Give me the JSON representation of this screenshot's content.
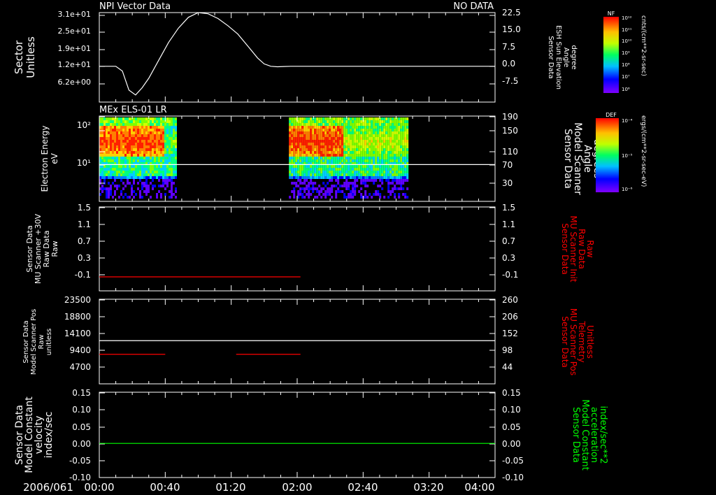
{
  "colors": {
    "background": "#000000",
    "axes": "#ffffff",
    "red_trace": "#ff0000",
    "green_trace": "#00ff00"
  },
  "footer": {
    "date": "2006/061",
    "time_ticks": [
      "00:00",
      "00:40",
      "01:20",
      "02:00",
      "02:40",
      "03:20",
      "04:00"
    ]
  },
  "chart_data": [
    {
      "type": "line",
      "panel": "npi",
      "title": "NPI Vector Data",
      "status": "NO DATA",
      "ylabel_left": [
        "Sector",
        "Unitless"
      ],
      "yticks_left": [
        "3.1e+01",
        "2.5e+01",
        "1.9e+01",
        "1.2e+01",
        "6.2e+00"
      ],
      "ylabel_right": [
        "Sensor Data",
        "ESH Sun Elevation",
        "Angle",
        "degree"
      ],
      "yticks_right": [
        "22.5",
        "15.0",
        "7.5",
        "0.0",
        "-7.5"
      ],
      "ylim_right": [
        -15,
        22.5
      ],
      "series": [
        {
          "x": [
            0,
            10,
            14,
            18,
            22,
            26,
            30,
            36,
            42,
            48,
            54,
            60,
            66,
            72,
            78,
            84,
            90,
            96,
            100,
            104,
            108,
            112,
            116,
            120,
            240
          ],
          "y": [
            0,
            0,
            -2,
            -10,
            -12,
            -9,
            -5,
            2.5,
            10,
            16,
            20.5,
            22.5,
            22,
            20,
            17,
            13.5,
            8.5,
            3.5,
            1,
            0,
            -0.2,
            -0.1,
            0,
            0,
            0
          ]
        }
      ]
    },
    {
      "type": "heatmap",
      "panel": "els",
      "title": "MEx ELS-01 LR",
      "ylabel_left": [
        "Electron Energy",
        "eV"
      ],
      "yticks_left": [
        "10²",
        "10¹"
      ],
      "ylabel_right": [
        "Sensor Data",
        "Model Scanner",
        "Angle",
        "degrees"
      ],
      "yticks_right": [
        "190",
        "150",
        "110",
        "70",
        "30"
      ],
      "ylim_right": [
        0,
        190
      ],
      "blocks": [
        {
          "x_start": 0,
          "x_end": 46
        },
        {
          "x_start": 115,
          "x_end": 187
        }
      ],
      "overlay_line": {
        "y": 82
      }
    },
    {
      "type": "line",
      "panel": "mu_raw",
      "ylabel_left": [
        "Sensor Data",
        "MU Scanner +30V",
        "Raw Data",
        "Raw"
      ],
      "yticks_left": [
        "1.5",
        "1.1",
        "0.7",
        "0.3",
        "-0.1"
      ],
      "ylabel_right": [
        "Sensor Data",
        "MU Scanner Init",
        "Raw Data",
        "Raw"
      ],
      "yticks_right": [
        "1.5",
        "1.1",
        "0.7",
        "0.3",
        "-0.1"
      ],
      "ylim": [
        -0.3,
        1.5
      ],
      "series": [
        {
          "x": [
            0,
            122
          ],
          "y": [
            0,
            0
          ],
          "color": "#ff0000"
        }
      ]
    },
    {
      "type": "line",
      "panel": "mu_pos",
      "ylabel_left": [
        "Sensor Data",
        "Model Scanner Pos",
        "Raw",
        "unitless"
      ],
      "yticks_left": [
        "23500",
        "18800",
        "14100",
        "9400",
        "4700"
      ],
      "ylabel_right": [
        "Sensor Data",
        "MU Scanner Pos",
        "Telemetry",
        "Unitless"
      ],
      "yticks_right": [
        "260",
        "206",
        "152",
        "98",
        "44"
      ],
      "ylim_left": [
        0,
        23500
      ],
      "series": [
        {
          "x": [
            0,
            240
          ],
          "y": [
            12000,
            12000
          ],
          "color": "#ffffff"
        },
        {
          "x": [
            0,
            40
          ],
          "y": [
            8200,
            8200
          ],
          "color": "#ff0000"
        },
        {
          "x": [
            83,
            122
          ],
          "y": [
            8200,
            8200
          ],
          "color": "#ff0000"
        }
      ]
    },
    {
      "type": "line",
      "panel": "model_const",
      "ylabel_left": [
        "Sensor Data",
        "Model Constant",
        "velocity",
        "index/sec"
      ],
      "yticks_left": [
        "0.15",
        "0.10",
        "0.05",
        "0.00",
        "-0.05",
        "-0.10"
      ],
      "ylabel_right": [
        "Sensor Data",
        "Model Constant",
        "acceleration",
        "index/sec**2"
      ],
      "yticks_right": [
        "0.15",
        "0.10",
        "0.05",
        "0.00",
        "-0.05",
        "-0.10"
      ],
      "ylim": [
        -0.1,
        0.15
      ],
      "series": [
        {
          "x": [
            0,
            240
          ],
          "y": [
            0,
            0
          ],
          "color": "#00ff00"
        }
      ]
    }
  ],
  "colorbars": [
    {
      "label": "NF",
      "units": "cnts/(cm**2-sr-sec)",
      "ticks": [
        "10¹²",
        "10¹¹",
        "10¹⁰",
        "10⁹",
        "10⁸",
        "10⁷",
        "10⁶"
      ]
    },
    {
      "label": "DEF",
      "units": "ergs/(cm**2-sr-sec-eV)",
      "ticks": [
        "10⁻⁴",
        "10⁻⁵",
        "10⁻⁶"
      ]
    }
  ]
}
